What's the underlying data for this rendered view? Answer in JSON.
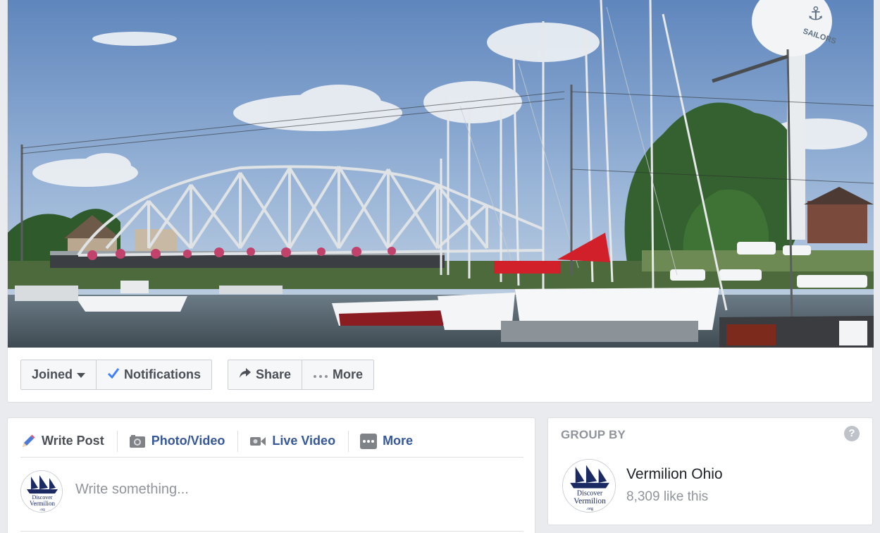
{
  "cover": {
    "image_alt": ""
  },
  "actions": {
    "joined_label": "Joined",
    "notifications_label": "Notifications",
    "share_label": "Share",
    "more_label": "More"
  },
  "composer": {
    "tabs": [
      {
        "label": "Write Post",
        "icon": "pencil-icon"
      },
      {
        "label": "Photo/Video",
        "icon": "camera-icon"
      },
      {
        "label": "Live Video",
        "icon": "video-camera-icon"
      },
      {
        "label": "More",
        "icon": "more-dots-icon"
      }
    ],
    "placeholder": "Write something..."
  },
  "group_by": {
    "title": "GROUP BY",
    "page_name": "Vermilion Ohio",
    "likes": "8,309 like this",
    "avatar_text": [
      "Discover",
      "Vermilion",
      ".org"
    ]
  },
  "watertower_text": "SAILORS",
  "colors": {
    "link": "#365899",
    "muted": "#90949c",
    "check": "#4080ff",
    "navy": "#1b2a63"
  }
}
